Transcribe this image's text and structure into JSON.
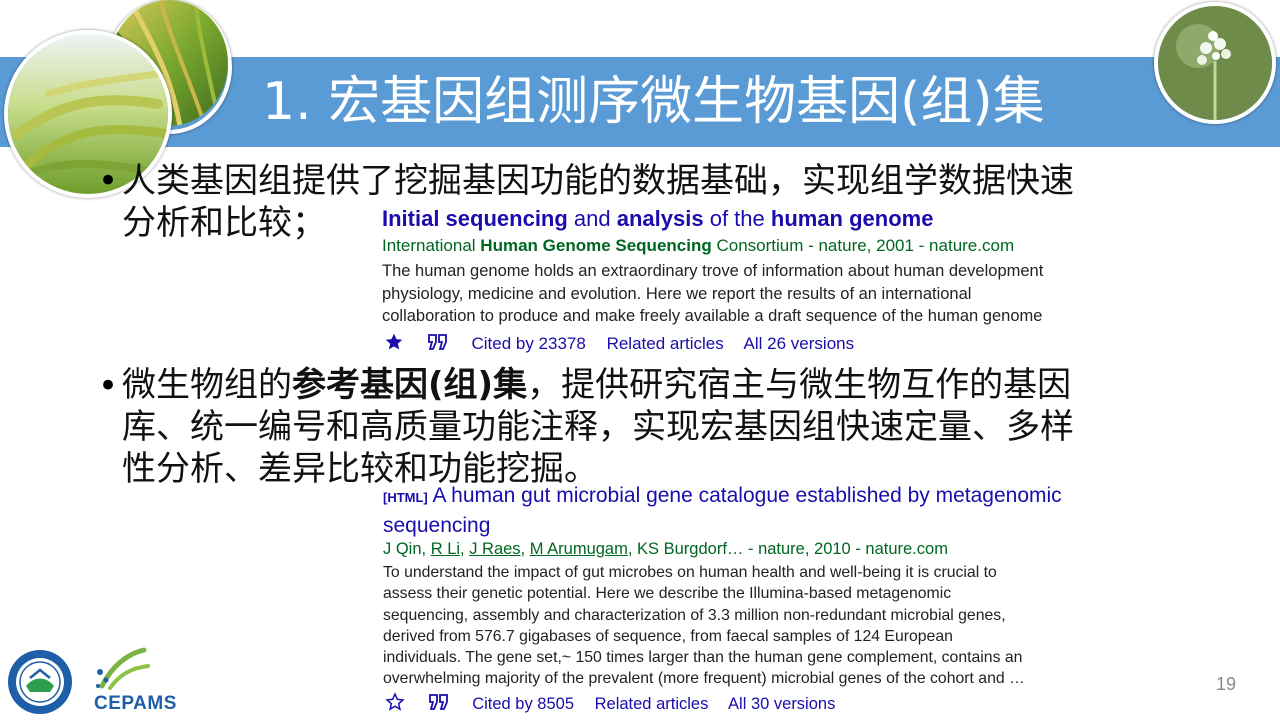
{
  "slide": {
    "title": "1. 宏基因组测序微生物基因(组)集",
    "page_number": "19",
    "bullets": [
      {
        "lines": [
          "人类基因组提供了挖掘基因功能的数据基础，实现组学数据快速",
          "分析和比较；"
        ]
      },
      {
        "line1_pre": "微生物组的",
        "line1_bold": "参考基因(组)集",
        "line1_post": "，提供研究宿主与微生物互作的基因",
        "line2": "库、统一编号和高质量功能注释，实现宏基因组快速定量、多样",
        "line3": "性分析、差异比较和功能挖掘。"
      }
    ]
  },
  "result1": {
    "title_parts": [
      "Initial sequencing",
      " and ",
      "analysis",
      " of the ",
      "human genome"
    ],
    "source_parts": [
      "International ",
      "Human Genome Sequencing",
      " Consortium - nature, 2001 - nature.com"
    ],
    "snippet": [
      "The human genome holds an extraordinary trove of information about human development",
      "physiology, medicine and evolution. Here we report the results of an international",
      "collaboration to produce and make freely available a draft sequence of the human genome"
    ],
    "cited_by": "Cited by 23378",
    "related": "Related articles",
    "versions": "All 26 versions"
  },
  "result2": {
    "tag": "[HTML]",
    "title_lines": [
      "A human gut microbial gene catalogue established by metagenomic",
      "sequencing"
    ],
    "authors": [
      "J Qin",
      "R Li",
      "J Raes",
      "M Arumugam"
    ],
    "source_rest": ", KS Burgdorf… - nature, 2010 - nature.com",
    "snippet": [
      "To understand the impact of gut microbes on human health and well-being it is crucial to",
      "assess their genetic potential. Here we describe the Illumina-based metagenomic",
      "sequencing, assembly and characterization of 3.3 million non-redundant microbial genes,",
      "derived from 576.7 gigabases of sequence, from faecal samples of 124 European",
      "individuals. The gene set,~ 150 times larger than the human gene complement, contains an",
      "overwhelming majority of the prevalent (more frequent) microbial genes of the cohort and …"
    ],
    "cited_by": "Cited by 8505",
    "related": "Related articles",
    "versions": "All 30 versions"
  },
  "logos": {
    "cepams": "CEPAMS"
  },
  "colors": {
    "title_bar": "#5b9bd5",
    "link_blue": "#1a0dab",
    "source_green": "#006621"
  },
  "icons": [
    "wheat-photo",
    "rice-photo",
    "arabidopsis-photo",
    "star-filled-icon",
    "star-outline-icon",
    "cite-quote-icon",
    "university-seal-logo",
    "cepams-logo"
  ]
}
